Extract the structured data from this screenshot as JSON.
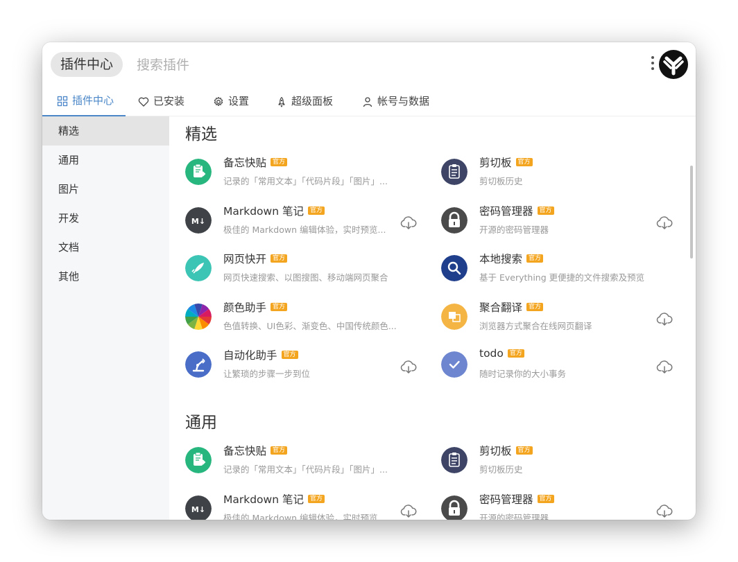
{
  "header": {
    "pill_label": "插件中心",
    "search_placeholder": "搜索插件"
  },
  "tabs": [
    {
      "label": "插件中心",
      "icon": "grid-icon"
    },
    {
      "label": "已安装",
      "icon": "heart-icon"
    },
    {
      "label": "设置",
      "icon": "gear-icon"
    },
    {
      "label": "超级面板",
      "icon": "rocket-icon"
    },
    {
      "label": "帐号与数据",
      "icon": "user-icon"
    }
  ],
  "sidebar": {
    "items": [
      {
        "label": "精选"
      },
      {
        "label": "通用"
      },
      {
        "label": "图片"
      },
      {
        "label": "开发"
      },
      {
        "label": "文档"
      },
      {
        "label": "其他"
      }
    ]
  },
  "badge_label": "官方",
  "sections": [
    {
      "title": "精选",
      "plugins": [
        {
          "name": "备忘快贴",
          "desc": "记录的「常用文本」「代码片段」「图片」...",
          "icon": "clipboard-memo-icon",
          "color": "#27b67e",
          "download": false
        },
        {
          "name": "剪切板",
          "desc": "剪切板历史",
          "icon": "clipboard-list-icon",
          "color": "#3d4466",
          "download": false
        },
        {
          "name": "Markdown 笔记",
          "desc": "极佳的 Markdown 编辑体验，实时预览...",
          "icon": "markdown-icon",
          "color": "#3f4347",
          "download": true
        },
        {
          "name": "密码管理器",
          "desc": "开源的密码管理器",
          "icon": "lock-icon",
          "color": "#4a4a4a",
          "download": true
        },
        {
          "name": "网页快开",
          "desc": "网页快速搜索、以图搜图、移动端网页聚合",
          "icon": "rocket-icon",
          "color": "#3cc5b4",
          "download": false
        },
        {
          "name": "本地搜索",
          "desc": "基于 Everything 更便捷的文件搜索及预览",
          "icon": "magnifier-icon",
          "color": "#1f3e8c",
          "download": false
        },
        {
          "name": "颜色助手",
          "desc": "色值转换、UI色彩、渐变色、中国传统颜色...",
          "icon": "color-wheel-icon",
          "color": "#e74c3c",
          "download": false
        },
        {
          "name": "聚合翻译",
          "desc": "浏览器方式聚合在线网页翻译",
          "icon": "translate-icon",
          "color": "#f5b545",
          "download": true
        },
        {
          "name": "自动化助手",
          "desc": "让繁琐的步骤一步到位",
          "icon": "robot-arm-icon",
          "color": "#4a6ec8",
          "download": true
        },
        {
          "name": "todo",
          "desc": "随时记录你的大小事务",
          "icon": "check-icon",
          "color": "#6e86d0",
          "download": true
        }
      ]
    },
    {
      "title": "通用",
      "plugins": [
        {
          "name": "备忘快贴",
          "desc": "记录的「常用文本」「代码片段」「图片」...",
          "icon": "clipboard-memo-icon",
          "color": "#27b67e",
          "download": false
        },
        {
          "name": "剪切板",
          "desc": "剪切板历史",
          "icon": "clipboard-list-icon",
          "color": "#3d4466",
          "download": false
        },
        {
          "name": "Markdown 笔记",
          "desc": "极佳的 Markdown 编辑体验，实时预览...",
          "icon": "markdown-icon",
          "color": "#3f4347",
          "download": true
        },
        {
          "name": "密码管理器",
          "desc": "开源的密码管理器",
          "icon": "lock-icon",
          "color": "#4a4a4a",
          "download": true
        }
      ]
    }
  ]
}
